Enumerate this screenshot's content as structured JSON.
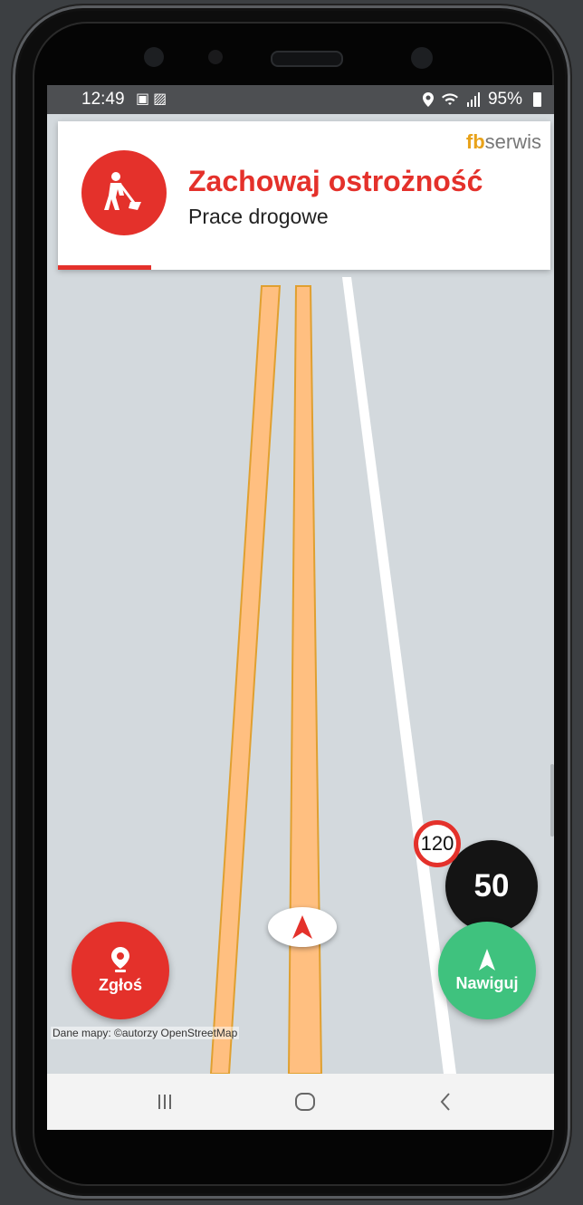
{
  "status_bar": {
    "time": "12:49",
    "left_icons": [
      "notification-icon",
      "image-icon"
    ],
    "battery": "95%"
  },
  "alert": {
    "brand_accent": "fb",
    "brand_rest": "serwis",
    "title": "Zachowaj ostrożność",
    "subtitle": "Prace drogowe",
    "icon": "roadworks-icon",
    "progress_fraction": 0.19
  },
  "speed": {
    "limit": "120",
    "current": "50"
  },
  "buttons": {
    "report_label": "Zgłoś",
    "navigate_label": "Nawiguj"
  },
  "map": {
    "attribution": "Dane mapy: ©autorzy OpenStreetMap"
  },
  "system_nav": [
    "recent-apps",
    "home",
    "back"
  ],
  "colors": {
    "accent_red": "#e4312b",
    "navigate_green": "#3fc27e",
    "road_orange": "#ffbf80",
    "map_background": "#d3d9dd"
  }
}
